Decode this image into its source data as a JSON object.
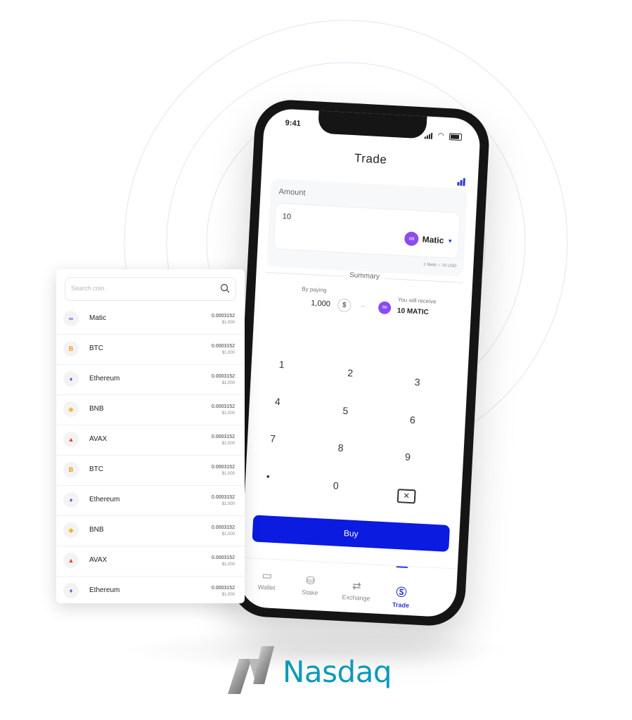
{
  "status_bar": {
    "time": "9:41"
  },
  "trade": {
    "title": "Trade",
    "amount_label": "Amount",
    "amount_value": "10",
    "coin": "Matic",
    "rate": "1 Matic = 10 USD",
    "summary_label": "Summary",
    "paying_label": "By paying",
    "paying_value": "1,000",
    "currency_symbol": "$",
    "receive_label": "You will receive",
    "receive_value": "10 MATIC"
  },
  "keypad": [
    "1",
    "2",
    "3",
    "4",
    "5",
    "6",
    "7",
    "8",
    "9",
    "•",
    "0"
  ],
  "buy_button": "Buy",
  "tabs": [
    {
      "label": "Wallet",
      "icon": "wallet-icon"
    },
    {
      "label": "Stake",
      "icon": "stake-icon"
    },
    {
      "label": "Exchange",
      "icon": "exchange-icon"
    },
    {
      "label": "Trade",
      "icon": "trade-icon",
      "active": true
    }
  ],
  "coin_panel": {
    "search_placeholder": "Search coin",
    "coins": [
      {
        "name": "Matic",
        "amount": "0.0003152",
        "usd": "$1,000",
        "color": "#8a4cf0",
        "glyph": "∞"
      },
      {
        "name": "BTC",
        "amount": "0.0003152",
        "usd": "$1,000",
        "color": "#f7931a",
        "glyph": "B"
      },
      {
        "name": "Ethereum",
        "amount": "0.0003152",
        "usd": "$1,000",
        "color": "#5b5ee0",
        "glyph": "♦"
      },
      {
        "name": "BNB",
        "amount": "0.0003152",
        "usd": "$1,000",
        "color": "#f3ba2f",
        "glyph": "◆"
      },
      {
        "name": "AVAX",
        "amount": "0.0003152",
        "usd": "$1,000",
        "color": "#e84142",
        "glyph": "▲"
      },
      {
        "name": "BTC",
        "amount": "0.0003152",
        "usd": "$1,000",
        "color": "#f7931a",
        "glyph": "B"
      },
      {
        "name": "Ethereum",
        "amount": "0.0003152",
        "usd": "$1,000",
        "color": "#5b5ee0",
        "glyph": "♦"
      },
      {
        "name": "BNB",
        "amount": "0.0003152",
        "usd": "$1,000",
        "color": "#f3ba2f",
        "glyph": "◆"
      },
      {
        "name": "AVAX",
        "amount": "0.0003152",
        "usd": "$1,000",
        "color": "#e84142",
        "glyph": "▲"
      },
      {
        "name": "Ethereum",
        "amount": "0.0003152",
        "usd": "$1,000",
        "color": "#5b5ee0",
        "glyph": "♦"
      }
    ]
  },
  "logo": {
    "text": "Nasdaq"
  },
  "colors": {
    "accent": "#0b1be0",
    "brand": "#0b9ab8",
    "matic": "#8a4cf0"
  }
}
